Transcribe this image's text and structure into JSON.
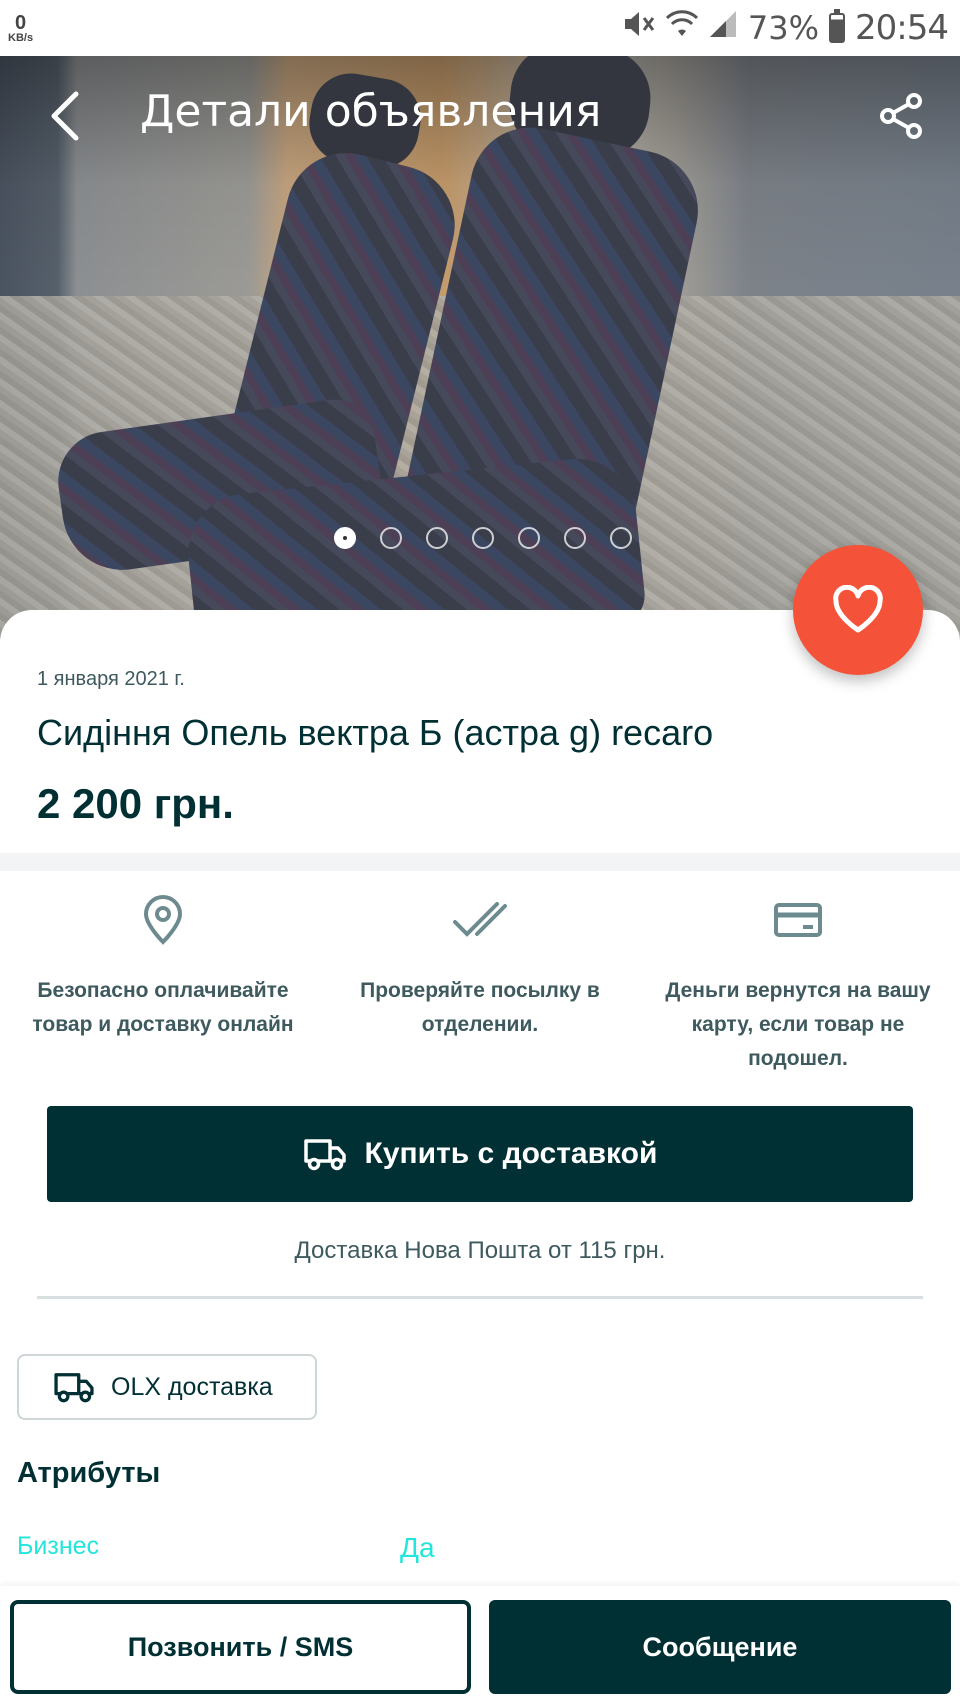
{
  "status_bar": {
    "net_speed": "0",
    "net_unit": "KB/s",
    "battery": "73%",
    "time": "20:54"
  },
  "header": {
    "title": "Детали объявления"
  },
  "gallery": {
    "photo_count": 7,
    "active_index": 1
  },
  "ad": {
    "date": "1 января 2021 г.",
    "title": "Сидіння Опель вектра Б (астра g) recaro",
    "price": "2 200 грн."
  },
  "features": [
    {
      "icon": "location-pin-icon",
      "text": "Безопасно оплачивайте товар и доставку онлайн"
    },
    {
      "icon": "double-check-icon",
      "text": "Проверяйте посылку в отделении."
    },
    {
      "icon": "card-icon",
      "text": "Деньги вернутся на вашу карту, если товар не подошел."
    }
  ],
  "buy": {
    "label": "Купить с доставкой",
    "delivery_note": "Доставка Нова Пошта от 115 грн."
  },
  "olx_delivery": {
    "label": "OLX доставка"
  },
  "attributes": {
    "heading": "Атрибуты",
    "items": [
      {
        "key": "Бизнес",
        "value": "Да"
      }
    ]
  },
  "bottom": {
    "call_label": "Позвонить / SMS",
    "message_label": "Сообщение"
  },
  "colors": {
    "brand_dark": "#002f34",
    "favorite": "#f4533a",
    "attr_link": "#23e5db"
  }
}
